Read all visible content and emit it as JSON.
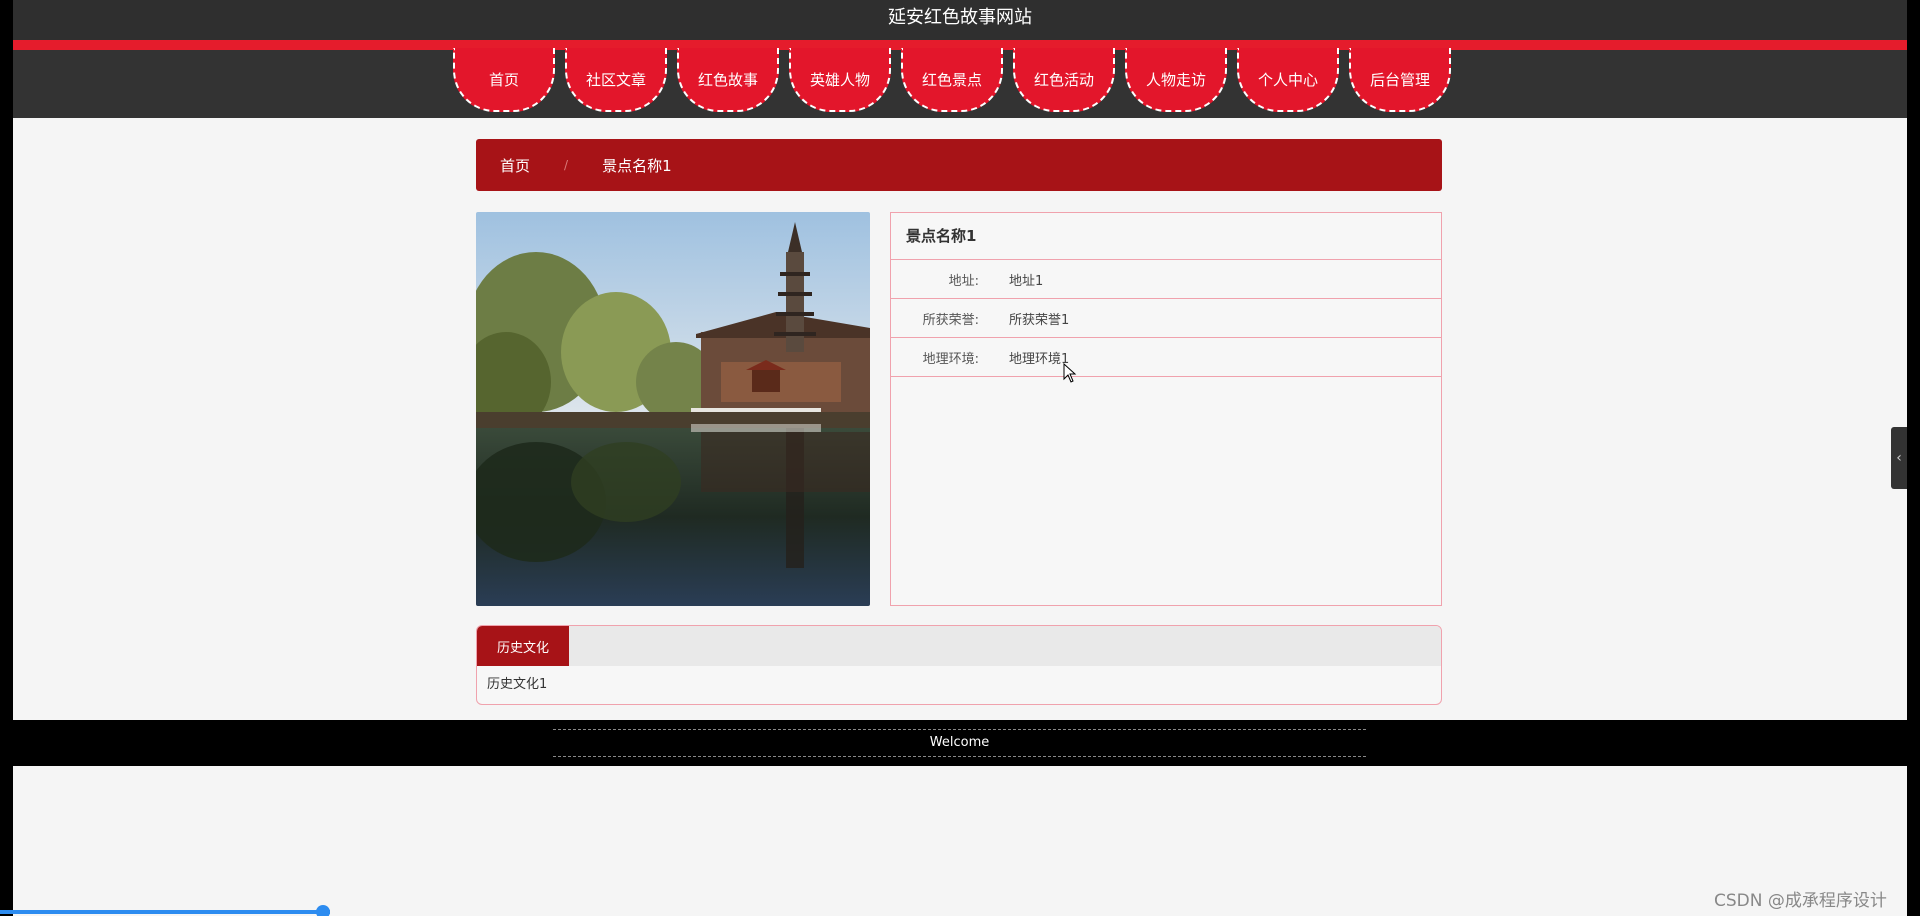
{
  "site": {
    "title": "延安红色故事网站"
  },
  "nav": {
    "items": [
      {
        "label": "首页"
      },
      {
        "label": "社区文章"
      },
      {
        "label": "红色故事"
      },
      {
        "label": "英雄人物"
      },
      {
        "label": "红色景点"
      },
      {
        "label": "红色活动"
      },
      {
        "label": "人物走访"
      },
      {
        "label": "个人中心"
      },
      {
        "label": "后台管理"
      }
    ]
  },
  "breadcrumb": {
    "home": "首页",
    "separator": "/",
    "current": "景点名称1"
  },
  "detail": {
    "name": "景点名称1",
    "rows": [
      {
        "label": "地址:",
        "value": "地址1"
      },
      {
        "label": "所获荣誉:",
        "value": "所获荣誉1"
      },
      {
        "label": "地理环境:",
        "value": "地理环境1"
      }
    ]
  },
  "tabs": {
    "items": [
      {
        "label": "历史文化"
      }
    ],
    "body": "历史文化1"
  },
  "footer": {
    "text": "Welcome"
  },
  "watermark": "CSDN @成承程序设计",
  "colors": {
    "brand_red": "#a71317",
    "nav_red": "#e3162b",
    "border_pink": "#f0a2ad"
  }
}
